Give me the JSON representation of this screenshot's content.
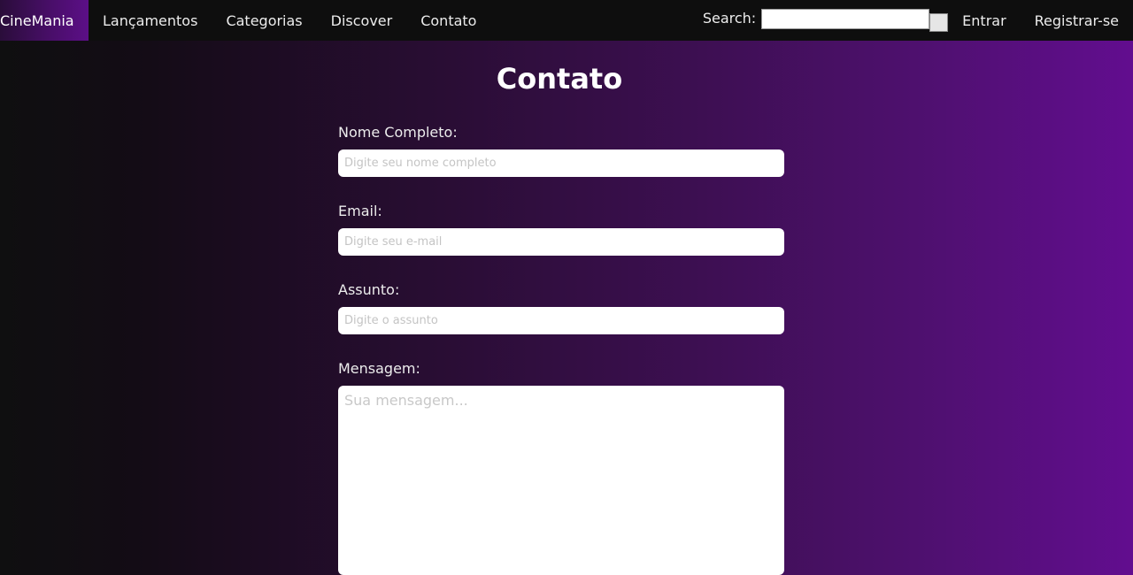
{
  "nav": {
    "brand": "CineMania",
    "links": [
      "Lançamentos",
      "Categorias",
      "Discover",
      "Contato"
    ],
    "search_label": "Search:",
    "search_value": "",
    "login": "Entrar",
    "register": "Registrar-se"
  },
  "page": {
    "title": "Contato"
  },
  "form": {
    "name_label": "Nome Completo:",
    "name_placeholder": "Digite seu nome completo",
    "email_label": "Email:",
    "email_placeholder": "Digite seu e-mail",
    "subject_label": "Assunto:",
    "subject_placeholder": "Digite o assunto",
    "message_label": "Mensagem:",
    "message_placeholder": "Sua mensagem..."
  },
  "colors": {
    "nav_bg": "#0e0e0e",
    "accent_purple": "#620d8f",
    "brand_bg": "#4a0e6b"
  }
}
